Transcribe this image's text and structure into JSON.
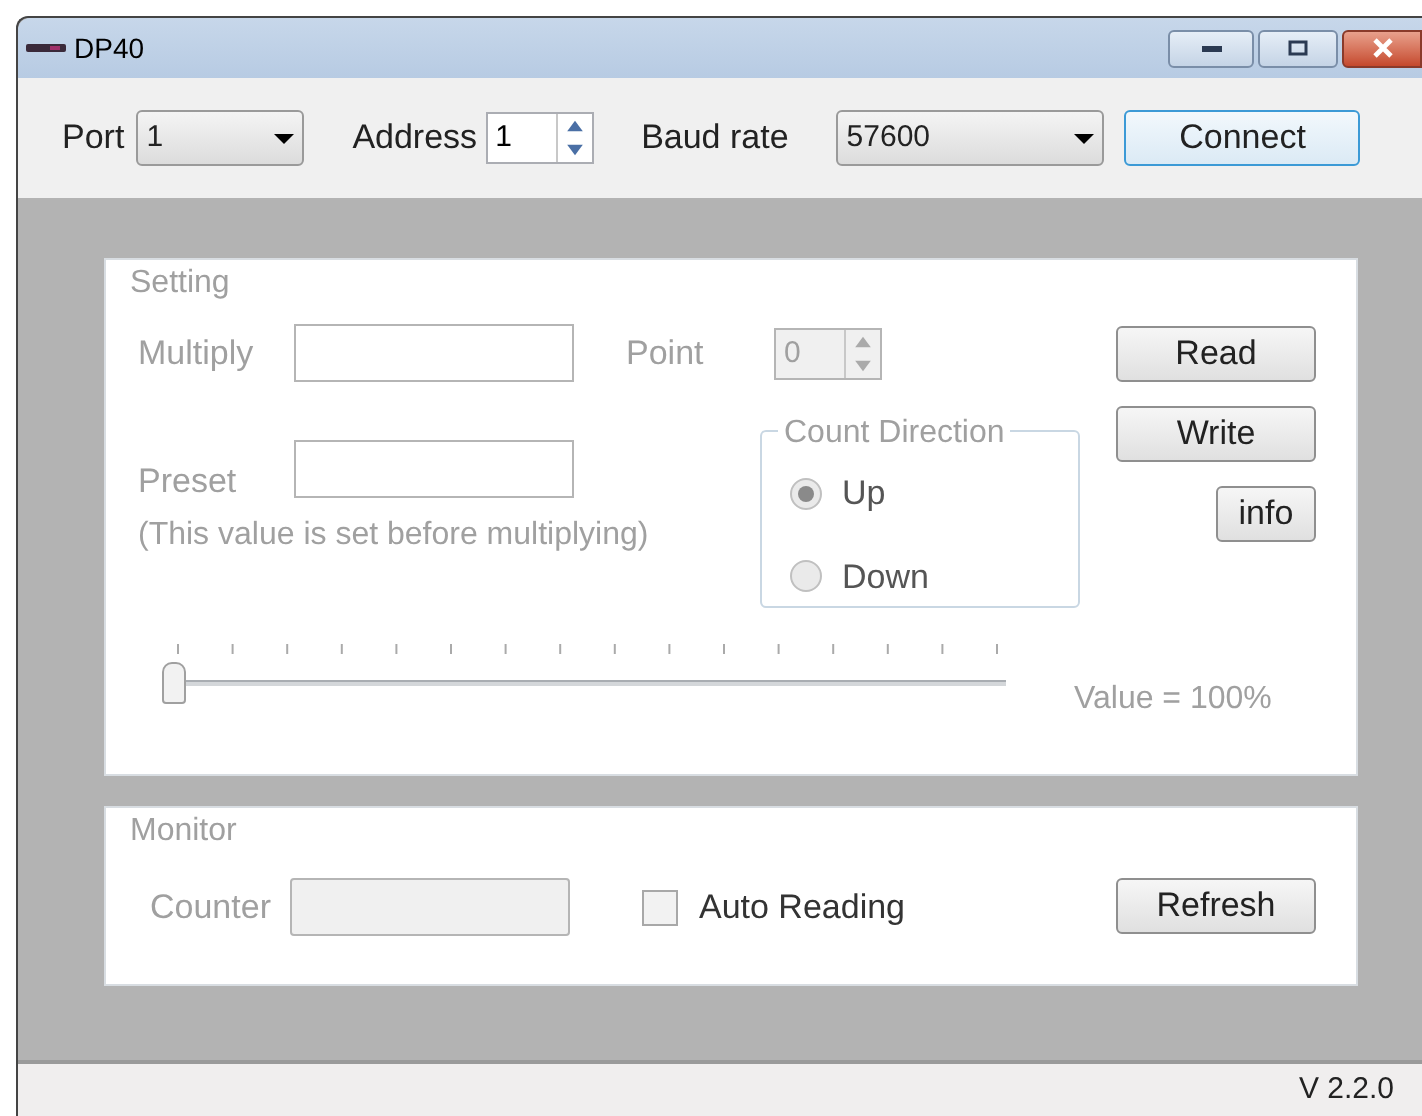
{
  "window": {
    "title": "DP40"
  },
  "toolbar": {
    "port": {
      "label": "Port",
      "value": "1"
    },
    "address": {
      "label": "Address",
      "value": "1"
    },
    "baud_rate": {
      "label": "Baud rate",
      "value": "57600"
    },
    "connect_button": "Connect"
  },
  "setting": {
    "title": "Setting",
    "disabled": true,
    "multiply": {
      "label": "Multiply"
    },
    "point": {
      "label": "Point",
      "value": "0"
    },
    "preset": {
      "label": "Preset",
      "note": "(This value is set before multiplying)"
    },
    "count_direction": {
      "title": "Count Direction",
      "options": [
        {
          "label": "Up",
          "selected": true
        },
        {
          "label": "Down",
          "selected": false
        }
      ]
    },
    "buttons": [
      "Read",
      "Write",
      "info"
    ],
    "slider": {
      "level": 0,
      "reading": "Value = 100%"
    }
  },
  "monitor": {
    "title": "Monitor",
    "counter": {
      "label": "Counter",
      "disabled": true
    },
    "auto_reading": {
      "label": "Auto Reading",
      "checked": false
    },
    "refresh_button": "Refresh"
  },
  "status_bar": {
    "version": "V 2.2.0"
  }
}
